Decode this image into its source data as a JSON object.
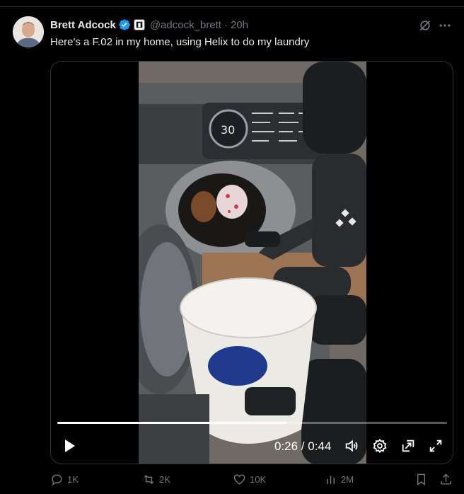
{
  "tweet": {
    "author_name": "Brett Adcock",
    "handle": "@adcock_brett",
    "separator": "·",
    "time": "20h",
    "text": "Here's a F.02 in my home, using Helix to do my laundry",
    "verified_color": "#1d9bf0"
  },
  "video": {
    "current_time": "0:26",
    "duration": "0:44",
    "time_display": "0:26 / 0:44",
    "progress_fraction": 0.59
  },
  "actions": {
    "replies": "1K",
    "reposts": "2K",
    "likes": "10K",
    "views": "2M"
  },
  "icons": {
    "grok": "grok-icon",
    "more": "more-horizontal-icon",
    "play": "play-icon",
    "volume": "volume-icon",
    "settings": "gear-icon",
    "pip": "picture-in-picture-icon",
    "fullscreen": "fullscreen-icon",
    "reply": "reply-icon",
    "repost": "repost-icon",
    "like": "heart-icon",
    "views": "views-icon",
    "bookmark": "bookmark-icon",
    "share": "share-icon"
  },
  "colors": {
    "background": "#000000",
    "text_primary": "#e7e9ea",
    "text_secondary": "#71767b",
    "border": "#2f3336",
    "accent": "#1d9bf0"
  }
}
